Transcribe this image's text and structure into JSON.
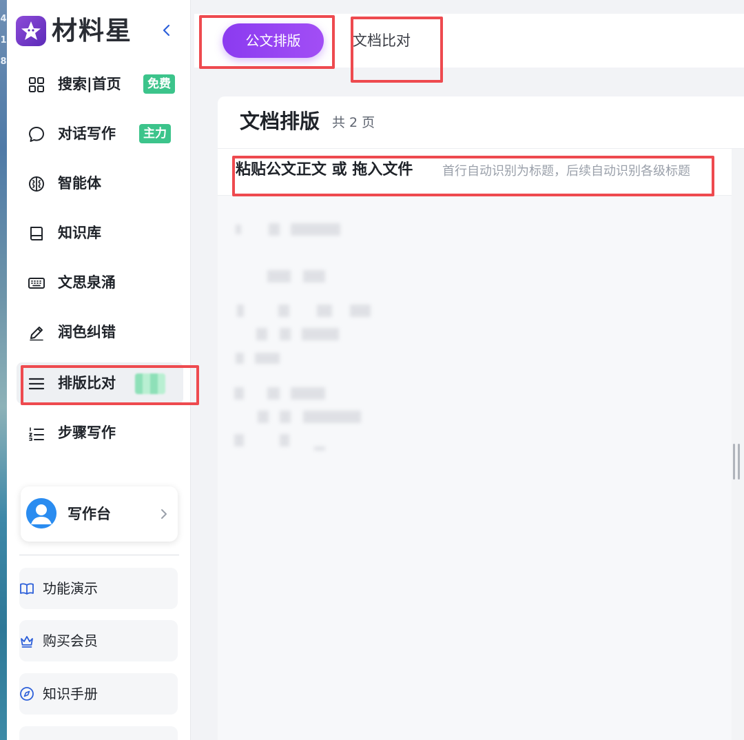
{
  "desktop": {
    "edge_digits": [
      "4",
      "1",
      "8"
    ]
  },
  "sidebar": {
    "logo_text": "材料星",
    "items": [
      {
        "label": "搜索|首页",
        "tag": "免费",
        "icon": "grid-icon"
      },
      {
        "label": "对话写作",
        "tag": "主力",
        "icon": "chat-bubble-icon"
      },
      {
        "label": "智能体",
        "icon": "brain-icon"
      },
      {
        "label": "知识库",
        "icon": "book-icon"
      },
      {
        "label": "文思泉涌",
        "icon": "keyboard-icon"
      },
      {
        "label": "润色纠错",
        "icon": "pencil-icon"
      },
      {
        "label": "排版比对",
        "icon": "menu-lines-icon",
        "active": true
      },
      {
        "label": "步骤写作",
        "icon": "numbered-list-icon"
      }
    ],
    "desk": {
      "label": "写作台"
    },
    "sub_items": [
      {
        "label": "功能演示",
        "icon": "open-book-icon"
      },
      {
        "label": "购买会员",
        "icon": "crown-icon"
      },
      {
        "label": "知识手册",
        "icon": "compass-icon"
      }
    ]
  },
  "topbar": {
    "tab_primary": "公文排版",
    "tab_secondary": "文档比对"
  },
  "card": {
    "title": "文档排版",
    "page_count": "共 2 页",
    "paste_title": "粘贴公文正文 或 拖入文件",
    "paste_hint": "首行自动识别为标题，后续自动识别各级标题"
  },
  "colors": {
    "accent_purple": "#8b3bf0",
    "tag_green": "#3cc48b",
    "annotation_red": "#ee4a4f"
  }
}
